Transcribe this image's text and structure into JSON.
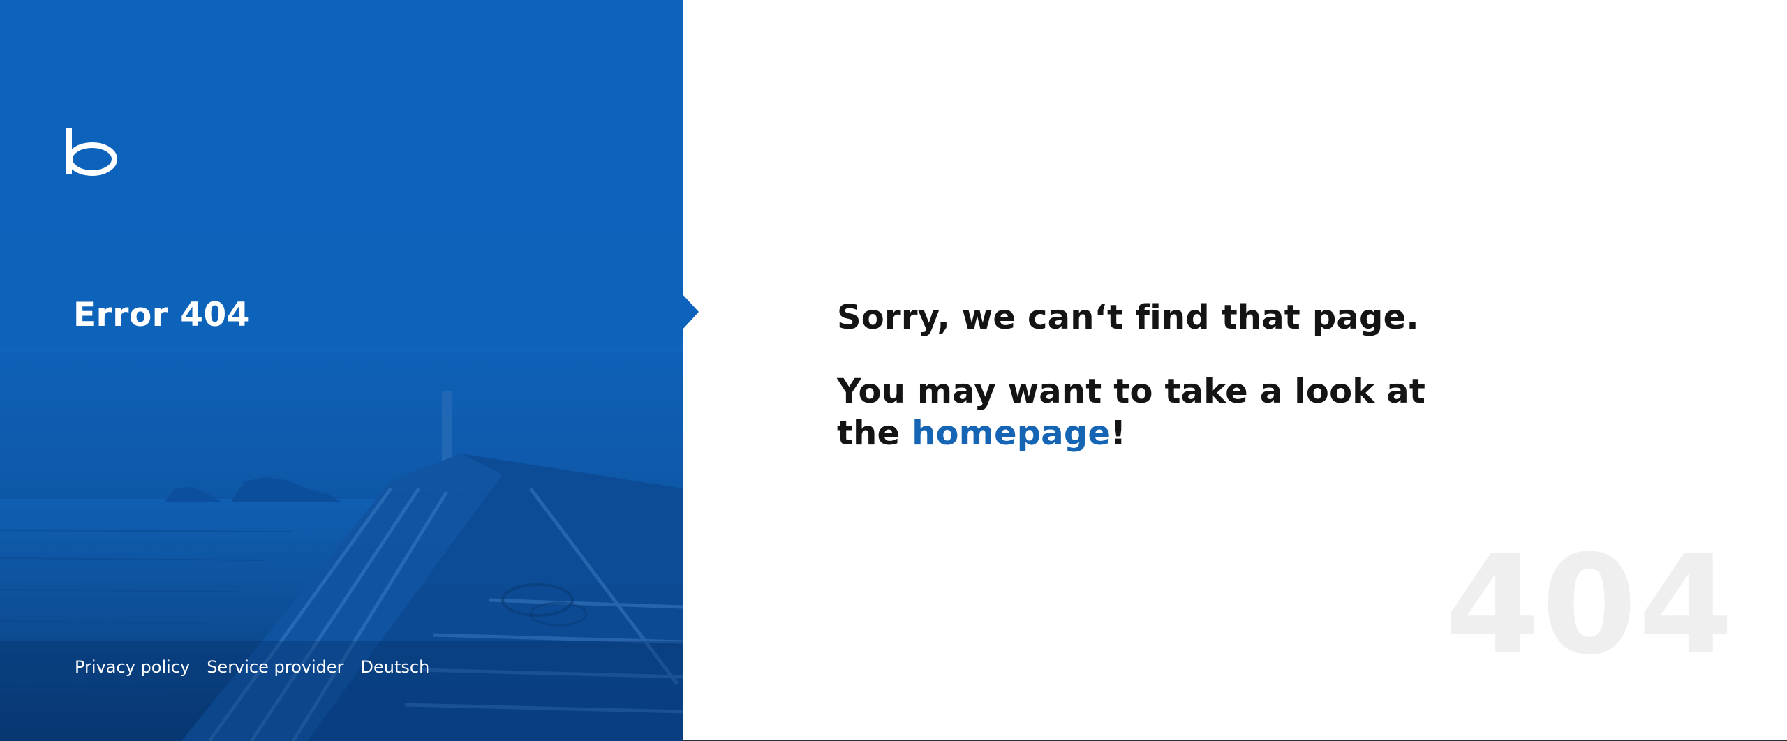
{
  "brand": {
    "logo_icon": "b-logo-icon",
    "primary_color": "#0d63bc",
    "link_color": "#1565b4"
  },
  "error": {
    "title": "Error 404",
    "watermark": "404"
  },
  "message": {
    "line1": "Sorry, we can‘t find that page.",
    "line2_start": "You may want to take a look at",
    "line3_prefix": "the ",
    "homepage_link": "homepage",
    "line3_suffix": "!"
  },
  "footer": {
    "links": [
      "Privacy policy",
      "Service provider",
      "Deutsch"
    ]
  }
}
